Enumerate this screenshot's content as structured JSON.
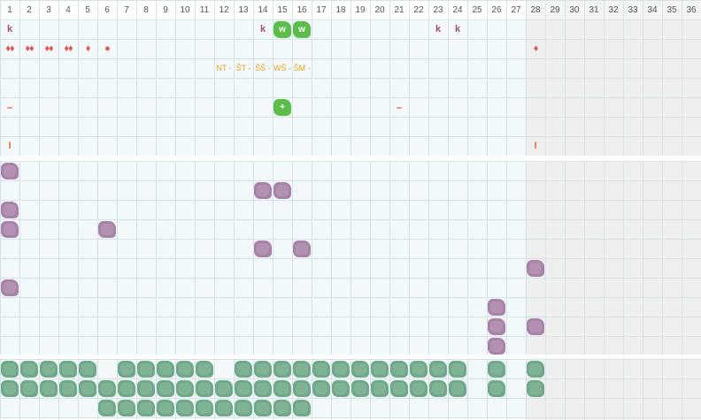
{
  "days": [
    "1",
    "2",
    "3",
    "4",
    "5",
    "6",
    "7",
    "8",
    "9",
    "10",
    "11",
    "12",
    "13",
    "14",
    "15",
    "16",
    "17",
    "18",
    "19",
    "20",
    "21",
    "22",
    "23",
    "24",
    "25",
    "26",
    "27",
    "28",
    "29",
    "30",
    "31",
    "32",
    "33",
    "34",
    "35",
    "36"
  ],
  "rows": {
    "k": {
      "cols": [
        1,
        14,
        23,
        24
      ],
      "glyph": "k"
    },
    "w": {
      "cols": [
        15,
        16
      ],
      "glyph": "w"
    },
    "drops": [
      {
        "col": 1,
        "glyph": "♦♦"
      },
      {
        "col": 2,
        "glyph": "♦♦"
      },
      {
        "col": 3,
        "glyph": "♦♦"
      },
      {
        "col": 4,
        "glyph": "♦♦"
      },
      {
        "col": 5,
        "glyph": "♦"
      },
      {
        "col": 6,
        "glyph": "●"
      },
      {
        "col": 28,
        "glyph": "♦"
      }
    ],
    "symptoms": [
      {
        "col": 12,
        "text": "NT -"
      },
      {
        "col": 13,
        "text": "ŠT -"
      },
      {
        "col": 14,
        "text": "ŠŠ -"
      },
      {
        "col": 15,
        "text": "WŠ -"
      },
      {
        "col": 16,
        "text": "ŠM -"
      }
    ],
    "dashes": {
      "cols": [
        1,
        21
      ],
      "glyph": "–"
    },
    "plus": {
      "col": 15,
      "glyph": "+"
    },
    "bars": {
      "cols": [
        1,
        28
      ],
      "glyph": "I"
    },
    "purple": [
      {
        "col": 1,
        "row": 0
      },
      {
        "col": 14,
        "row": 1
      },
      {
        "col": 15,
        "row": 1
      },
      {
        "col": 1,
        "row": 2
      },
      {
        "col": 1,
        "row": 3
      },
      {
        "col": 6,
        "row": 3
      },
      {
        "col": 14,
        "row": 4
      },
      {
        "col": 16,
        "row": 4
      },
      {
        "col": 28,
        "row": 5
      },
      {
        "col": 1,
        "row": 6
      },
      {
        "col": 26,
        "row": 7
      },
      {
        "col": 26,
        "row": 8
      },
      {
        "col": 28,
        "row": 8
      },
      {
        "col": 26,
        "row": 9
      }
    ],
    "green_rows": [
      [
        1,
        2,
        3,
        4,
        5,
        7,
        8,
        9,
        10,
        11,
        13,
        14,
        15,
        16,
        17,
        18,
        19,
        20,
        21,
        22,
        23,
        24,
        26,
        28
      ],
      [
        1,
        2,
        3,
        4,
        5,
        6,
        7,
        8,
        9,
        10,
        11,
        12,
        13,
        14,
        15,
        16,
        17,
        18,
        19,
        20,
        21,
        22,
        23,
        24,
        26,
        28
      ],
      [
        6,
        7,
        8,
        9,
        10,
        11,
        12,
        13,
        14,
        15,
        16
      ]
    ]
  },
  "colors": {
    "purple": "#a882a8",
    "green": "#6fa988",
    "lime": "#5cbd4a",
    "accent": "#e46a3a",
    "k": "#a0526e"
  }
}
